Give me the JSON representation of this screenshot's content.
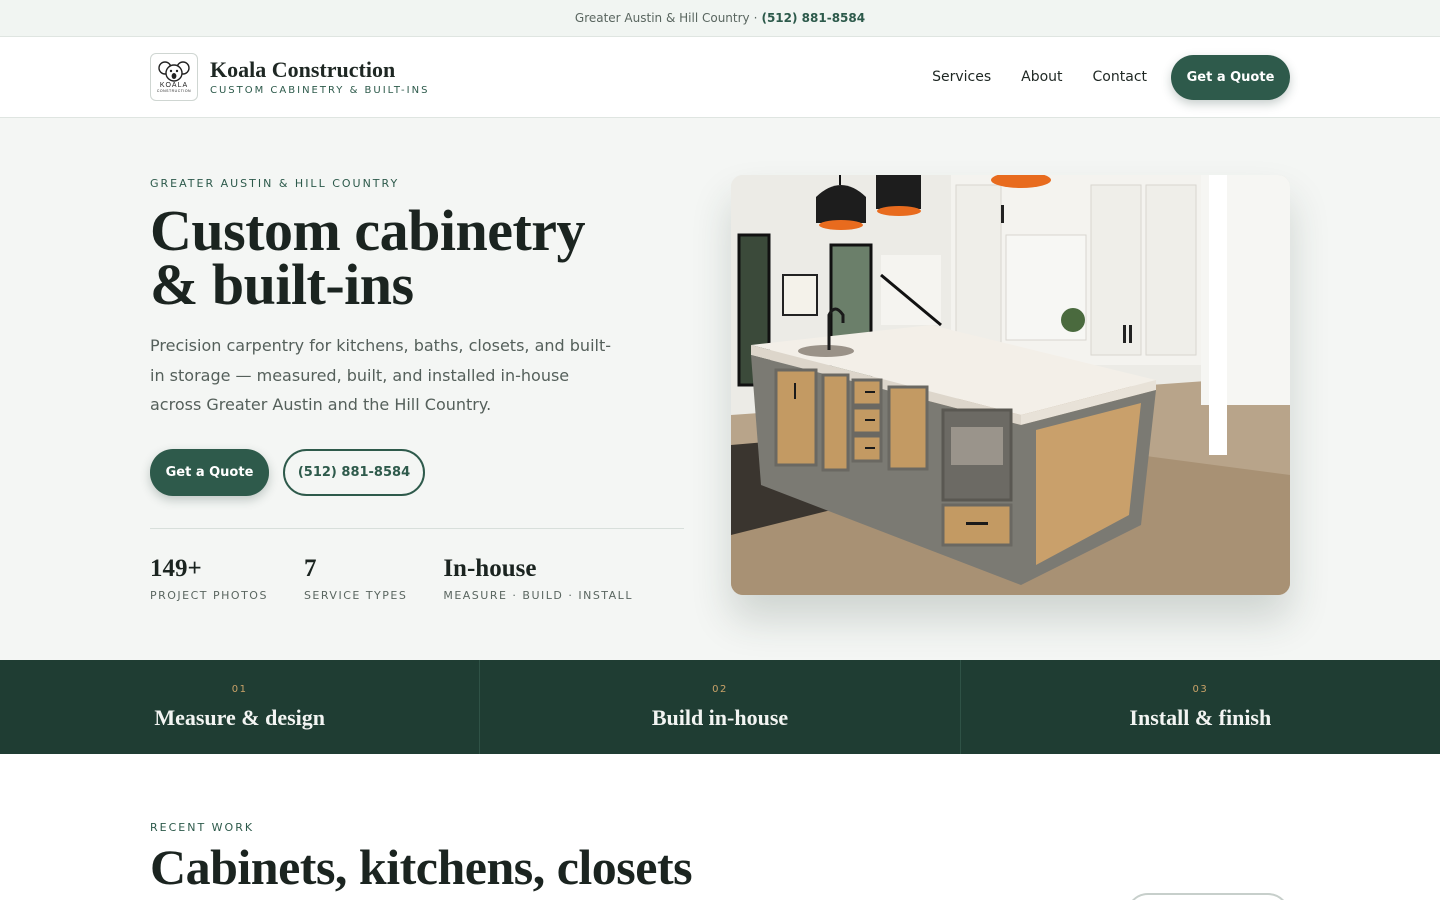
{
  "topbar": {
    "region": "Greater Austin & Hill Country",
    "separator": "·",
    "phone": "(512) 881-8584"
  },
  "header": {
    "logo_text": "KOALA",
    "logo_subtext": "CONSTRUCTION",
    "brand_name": "Koala Construction",
    "brand_tagline": "CUSTOM CABINETRY & BUILT-INS",
    "nav": [
      "Services",
      "About",
      "Contact"
    ],
    "cta": "Get a Quote"
  },
  "hero": {
    "eyebrow": "GREATER AUSTIN & HILL COUNTRY",
    "title_line1": "Custom cabinetry",
    "title_line2": "& built-ins",
    "description": "Precision carpentry for kitchens, baths, closets, and built-in storage — measured, built, and installed in-house across Greater Austin and the Hill Country.",
    "cta_primary": "Get a Quote",
    "cta_secondary": "(512) 881-8584",
    "stats": [
      {
        "value": "149+",
        "label": "PROJECT PHOTOS"
      },
      {
        "value": "7",
        "label": "SERVICE TYPES"
      },
      {
        "value": "In-house",
        "label": "MEASURE · BUILD · INSTALL"
      }
    ]
  },
  "steps": [
    {
      "num": "01",
      "title": "Measure & design"
    },
    {
      "num": "02",
      "title": "Build in-house"
    },
    {
      "num": "03",
      "title": "Install & finish"
    }
  ],
  "recent": {
    "eyebrow": "RECENT WORK",
    "title": "Cabinets, kitchens, closets"
  },
  "colors": {
    "brand_green": "#2e5a4b",
    "band_dark": "#1f3d33",
    "accent_gold": "#c9a268",
    "page_bg": "#f4f6f4"
  }
}
